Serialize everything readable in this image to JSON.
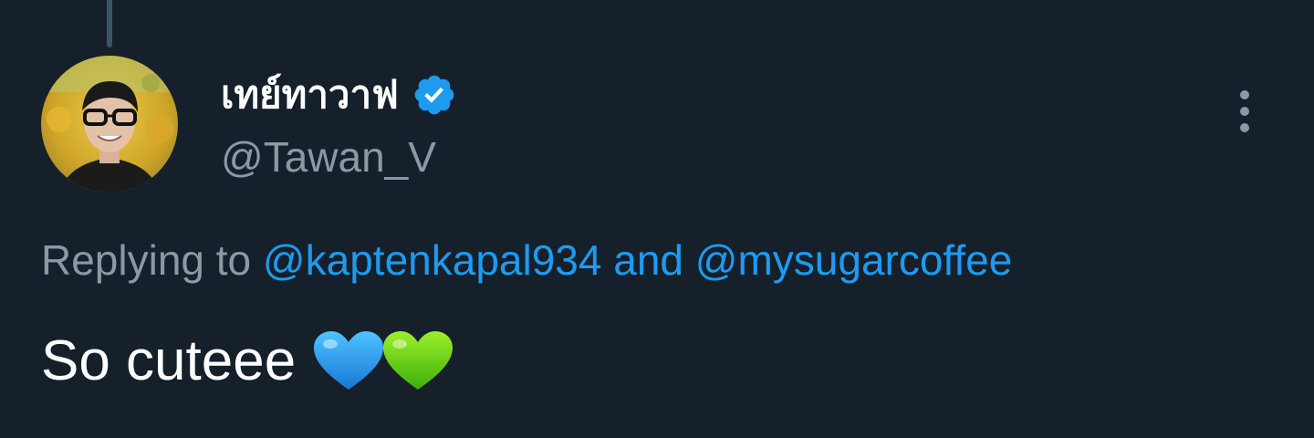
{
  "tweet": {
    "author": {
      "display_name": "เทย์ทาวาฟ",
      "handle": "@Tawan_V",
      "verified": true,
      "avatar": "profile-photo"
    },
    "reply": {
      "prefix": "Replying to",
      "mention_1": "@kaptenkapal934",
      "conjunction": "and",
      "mention_2": "@mysugarcoffee"
    },
    "text": "So cuteee",
    "emojis": [
      "blue-heart-emoji",
      "green-heart-emoji"
    ]
  },
  "icons": {
    "verified": "verified-badge-icon",
    "more": "more-options-icon"
  },
  "colors": {
    "background": "#15202b",
    "primary_text": "#ffffff",
    "secondary_text": "#8b98a5",
    "link": "#1d9bf0",
    "thread_line": "#3d5466"
  }
}
